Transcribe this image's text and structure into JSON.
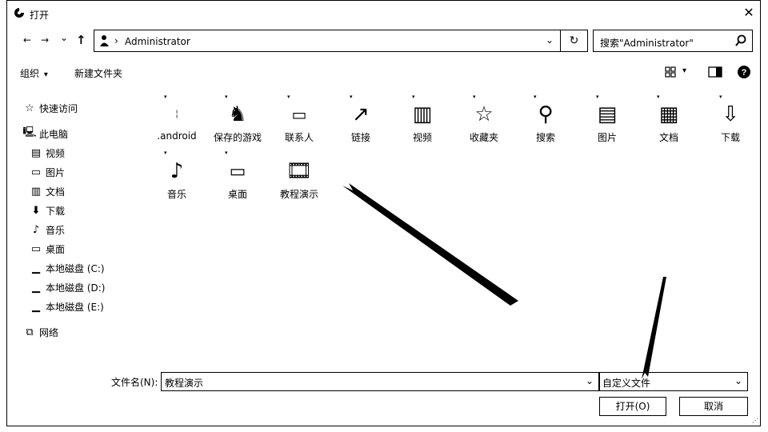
{
  "window": {
    "title": "打开",
    "close_symbol": "✕"
  },
  "nav": {
    "back": "←",
    "forward": "→",
    "recent": "⌄",
    "up": "↑"
  },
  "address": {
    "path_sep": "›",
    "path": "Administrator",
    "dropdown": "⌄",
    "refresh": "↻"
  },
  "search": {
    "placeholder": "搜索\"Administrator\""
  },
  "toolbar": {
    "organize": "组织",
    "organize_caret": "▾",
    "new_folder": "新建文件夹",
    "view_caret": "▾"
  },
  "sidebar": {
    "items": [
      {
        "label": "快速访问",
        "icon": "star-icon"
      },
      {
        "label": "此电脑",
        "icon": "computer-icon"
      },
      {
        "label": "视频",
        "icon": "video-icon"
      },
      {
        "label": "图片",
        "icon": "picture-icon"
      },
      {
        "label": "文档",
        "icon": "document-icon"
      },
      {
        "label": "下载",
        "icon": "download-icon"
      },
      {
        "label": "音乐",
        "icon": "music-icon"
      },
      {
        "label": "桌面",
        "icon": "desktop-icon"
      },
      {
        "label": "本地磁盘 (C:)",
        "icon": "disk-icon"
      },
      {
        "label": "本地磁盘 (D:)",
        "icon": "disk-icon"
      },
      {
        "label": "本地磁盘 (E:)",
        "icon": "disk-icon"
      },
      {
        "label": "网络",
        "icon": "network-icon"
      }
    ]
  },
  "files": [
    {
      "label": ".android",
      "icon": "folder-icon"
    },
    {
      "label": "保存的游戏",
      "icon": "saved-games-icon"
    },
    {
      "label": "联系人",
      "icon": "contacts-icon"
    },
    {
      "label": "链接",
      "icon": "links-icon"
    },
    {
      "label": "视频",
      "icon": "video-icon"
    },
    {
      "label": "收藏夹",
      "icon": "favorites-icon"
    },
    {
      "label": "搜索",
      "icon": "search-folder-icon"
    },
    {
      "label": "图片",
      "icon": "picture-icon"
    },
    {
      "label": "文档",
      "icon": "document-icon"
    },
    {
      "label": "下载",
      "icon": "download-icon"
    },
    {
      "label": "音乐",
      "icon": "music-icon"
    },
    {
      "label": "桌面",
      "icon": "desktop-icon"
    },
    {
      "label": "教程演示",
      "icon": "video-folder-icon"
    }
  ],
  "footer": {
    "filename_label": "文件名(N):",
    "filename_value": "教程演示",
    "filename_dropdown": "⌄",
    "filter_value": "自定义文件",
    "filter_dropdown": "⌄",
    "open_button": "打开(O)",
    "cancel_button": "取消"
  }
}
